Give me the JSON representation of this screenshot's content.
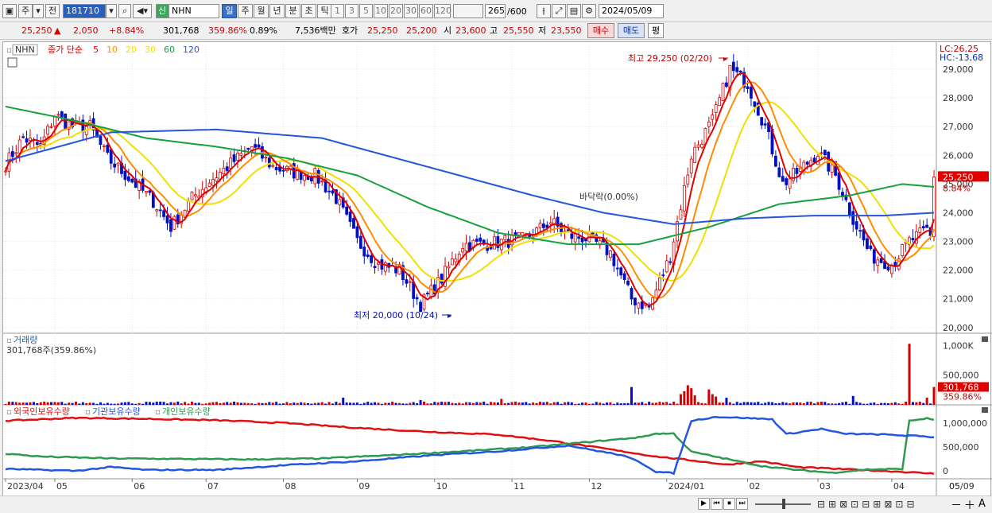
{
  "toolbar": {
    "period_a": "주",
    "period_b": "전",
    "code": "181710",
    "stock_name": "NHN",
    "market_badge": "신",
    "intervals": [
      "일",
      "주",
      "월",
      "년",
      "분",
      "초",
      "틱"
    ],
    "minutes": [
      "1",
      "3",
      "5",
      "10",
      "20",
      "30",
      "60",
      "120"
    ],
    "count": "265",
    "count_max": "/600",
    "date": "2024/05/09"
  },
  "quote": {
    "price": "25,250",
    "arrow": "▲",
    "change": "2,050",
    "change_pct": "+8.84%",
    "volume": "301,768",
    "vol_pct": "359.86%",
    "turnover": "0.89%",
    "amount": "7,536백만",
    "ask_label": "호가",
    "ask": "25,250",
    "bid": "25,200",
    "open_label": "시",
    "open": "23,600",
    "high_label": "고",
    "high": "25,550",
    "low_label": "저",
    "low": "23,550",
    "buy": "매수",
    "sell": "매도",
    "eval": "평"
  },
  "colors": {
    "up": "#d00000",
    "down": "#0010c0",
    "ma5": "#e00000",
    "ma10": "#ff8c00",
    "ma20": "#f0e000",
    "ma60": "#16a040",
    "ma120": "#2255e0",
    "foreign": "#e01010",
    "institution": "#2255e0",
    "individual": "#2c9a50"
  },
  "chart_data": {
    "type": "candlestick",
    "price_panel": {
      "legend_name": "NHN",
      "legend_desc": "종가 단순",
      "ma_periods": [
        "5",
        "10",
        "20",
        "30",
        "60",
        "120"
      ],
      "lc_label": "LC:26,25",
      "hc_label": "HC:-13,68",
      "y_ticks": [
        "29,000",
        "28,000",
        "27,000",
        "26,000",
        "25,000",
        "24,000",
        "23,000",
        "22,000",
        "21,000",
        "20,000"
      ],
      "ylim": [
        19800,
        29500
      ],
      "current_price_tag": "25,250",
      "current_pct_tag": "8.84%",
      "max_annotation": "최고 29,250 (02/20)",
      "min_annotation": "최저 20,000 (10/24)",
      "mid_annotation": "바닥락(0.00%)",
      "close_anchors": [
        [
          0,
          25700
        ],
        [
          5,
          26600
        ],
        [
          10,
          26300
        ],
        [
          14,
          27400
        ],
        [
          19,
          27000
        ],
        [
          24,
          27000
        ],
        [
          29,
          25900
        ],
        [
          36,
          25100
        ],
        [
          42,
          24400
        ],
        [
          47,
          23500
        ],
        [
          53,
          24500
        ],
        [
          58,
          25100
        ],
        [
          64,
          25700
        ],
        [
          70,
          26300
        ],
        [
          76,
          25600
        ],
        [
          82,
          25400
        ],
        [
          88,
          25300
        ],
        [
          94,
          24500
        ],
        [
          100,
          23000
        ],
        [
          106,
          22200
        ],
        [
          112,
          22000
        ],
        [
          118,
          20800
        ],
        [
          124,
          21700
        ],
        [
          130,
          22900
        ],
        [
          136,
          22900
        ],
        [
          142,
          23000
        ],
        [
          148,
          23100
        ],
        [
          155,
          23700
        ],
        [
          160,
          23200
        ],
        [
          166,
          23100
        ],
        [
          172,
          22600
        ],
        [
          178,
          21000
        ],
        [
          183,
          20700
        ],
        [
          189,
          22500
        ],
        [
          195,
          26000
        ],
        [
          201,
          27200
        ],
        [
          206,
          29000
        ],
        [
          211,
          28500
        ],
        [
          216,
          27000
        ],
        [
          221,
          25000
        ],
        [
          226,
          25500
        ],
        [
          231,
          26100
        ],
        [
          236,
          25300
        ],
        [
          241,
          23800
        ],
        [
          246,
          22500
        ],
        [
          252,
          22200
        ],
        [
          257,
          23000
        ],
        [
          262,
          23400
        ],
        [
          264,
          25250
        ]
      ],
      "ma60_anchors": [
        [
          0,
          27700
        ],
        [
          20,
          27200
        ],
        [
          40,
          26600
        ],
        [
          60,
          26300
        ],
        [
          80,
          25900
        ],
        [
          100,
          25300
        ],
        [
          120,
          24200
        ],
        [
          140,
          23300
        ],
        [
          160,
          22900
        ],
        [
          180,
          22900
        ],
        [
          200,
          23500
        ],
        [
          220,
          24300
        ],
        [
          240,
          24600
        ],
        [
          255,
          25000
        ],
        [
          264,
          24900
        ]
      ],
      "ma120_anchors": [
        [
          0,
          25800
        ],
        [
          30,
          26800
        ],
        [
          60,
          26900
        ],
        [
          90,
          26600
        ],
        [
          120,
          25600
        ],
        [
          150,
          24600
        ],
        [
          170,
          24000
        ],
        [
          190,
          23600
        ],
        [
          210,
          23800
        ],
        [
          230,
          23900
        ],
        [
          250,
          23900
        ],
        [
          264,
          24000
        ]
      ]
    },
    "volume_panel": {
      "title": "거래량",
      "readout": "301,768주(359.86%)",
      "y_ticks": [
        "1,000K",
        "500,000"
      ],
      "ylim": [
        0,
        1100000
      ],
      "current_tag": "301,768",
      "current_pct": "359.86%",
      "spikes": [
        [
          96,
          120000
        ],
        [
          118,
          80000
        ],
        [
          141,
          100000
        ],
        [
          178,
          300000
        ],
        [
          192,
          180000
        ],
        [
          193,
          230000
        ],
        [
          194,
          330000
        ],
        [
          195,
          280000
        ],
        [
          196,
          160000
        ],
        [
          200,
          260000
        ],
        [
          201,
          180000
        ],
        [
          202,
          140000
        ],
        [
          205,
          120000
        ],
        [
          241,
          150000
        ],
        [
          257,
          1030000
        ],
        [
          262,
          120000
        ],
        [
          264,
          301768
        ]
      ]
    },
    "holdings_panel": {
      "series_names": [
        "외국인보유수량",
        "기관보유수량",
        "개인보유수량"
      ],
      "y_ticks": [
        "1,000,000",
        "500,000",
        "0"
      ],
      "ylim": [
        -150000,
        1250000
      ],
      "foreign_anchors": [
        [
          0,
          1050000
        ],
        [
          20,
          1110000
        ],
        [
          40,
          1090000
        ],
        [
          60,
          1060000
        ],
        [
          80,
          1000000
        ],
        [
          100,
          900000
        ],
        [
          120,
          820000
        ],
        [
          140,
          760000
        ],
        [
          155,
          630000
        ],
        [
          170,
          470000
        ],
        [
          185,
          300000
        ],
        [
          195,
          220000
        ],
        [
          205,
          130000
        ],
        [
          215,
          200000
        ],
        [
          225,
          80000
        ],
        [
          240,
          30000
        ],
        [
          255,
          -20000
        ],
        [
          264,
          -60000
        ]
      ],
      "institution_anchors": [
        [
          0,
          40000
        ],
        [
          20,
          0
        ],
        [
          30,
          80000
        ],
        [
          40,
          20000
        ],
        [
          60,
          20000
        ],
        [
          80,
          120000
        ],
        [
          100,
          200000
        ],
        [
          120,
          320000
        ],
        [
          140,
          410000
        ],
        [
          160,
          530000
        ],
        [
          175,
          330000
        ],
        [
          180,
          200000
        ],
        [
          185,
          -20000
        ],
        [
          190,
          -50000
        ],
        [
          195,
          1050000
        ],
        [
          202,
          1130000
        ],
        [
          210,
          1110000
        ],
        [
          218,
          1080000
        ],
        [
          222,
          770000
        ],
        [
          232,
          880000
        ],
        [
          238,
          780000
        ],
        [
          250,
          760000
        ],
        [
          262,
          720000
        ],
        [
          264,
          700000
        ]
      ],
      "individual_anchors": [
        [
          0,
          360000
        ],
        [
          10,
          300000
        ],
        [
          30,
          260000
        ],
        [
          50,
          250000
        ],
        [
          70,
          240000
        ],
        [
          90,
          260000
        ],
        [
          110,
          330000
        ],
        [
          130,
          410000
        ],
        [
          150,
          500000
        ],
        [
          165,
          600000
        ],
        [
          180,
          700000
        ],
        [
          185,
          780000
        ],
        [
          190,
          780000
        ],
        [
          195,
          400000
        ],
        [
          205,
          250000
        ],
        [
          215,
          100000
        ],
        [
          225,
          20000
        ],
        [
          235,
          -40000
        ],
        [
          245,
          30000
        ],
        [
          255,
          40000
        ],
        [
          257,
          1050000
        ],
        [
          262,
          1100000
        ],
        [
          264,
          1070000
        ]
      ]
    },
    "x_ticks": [
      "2023/04",
      "05",
      "06",
      "07",
      "08",
      "09",
      "10",
      "11",
      "12",
      "2024/01",
      "02",
      "03",
      "04",
      "05",
      "05/09"
    ],
    "x_tick_index": [
      0,
      14,
      36,
      57,
      79,
      100,
      122,
      144,
      166,
      188,
      211,
      231,
      252,
      274,
      290
    ]
  },
  "bottom_bar": {
    "nav": [
      "▶",
      "⏮",
      "⏹",
      "⏭"
    ],
    "zoom": [
      "－",
      "＋"
    ],
    "a_label": "A"
  }
}
